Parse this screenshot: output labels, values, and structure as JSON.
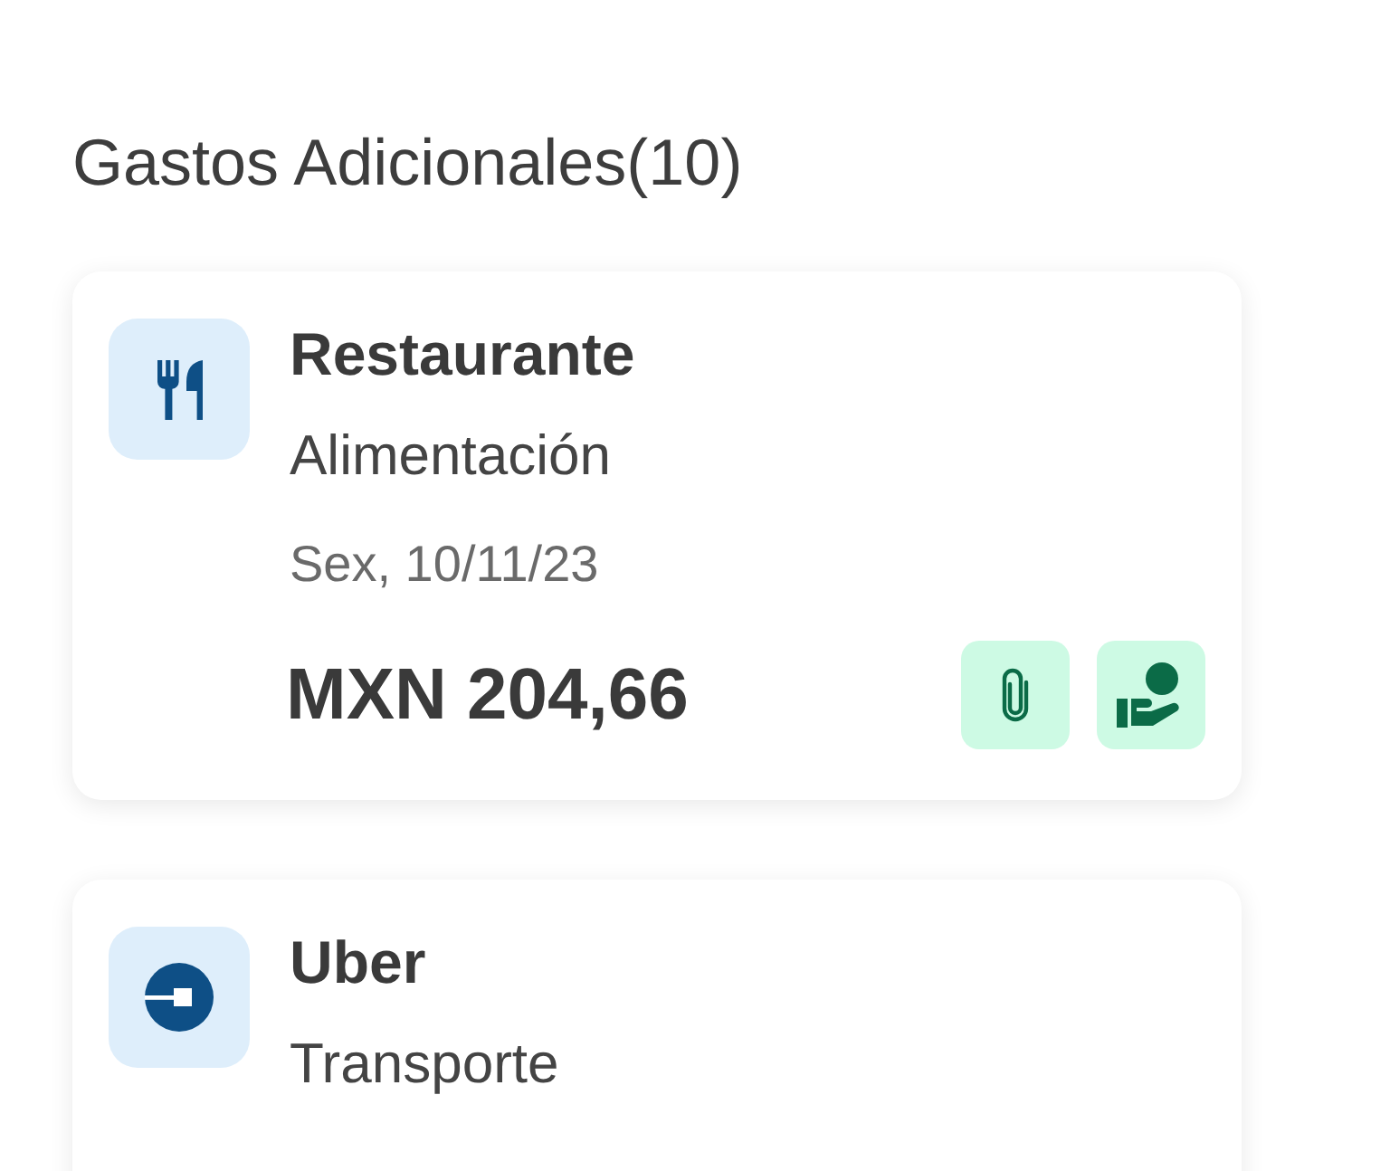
{
  "section": {
    "title": "Gastos Adicionales(10)"
  },
  "expenses": [
    {
      "kind": "food",
      "name": "Restaurante",
      "category": "Alimentación",
      "date": "Sex, 10/11/23",
      "amount": "MXN 204,66",
      "actions": [
        {
          "kind": "attachment"
        },
        {
          "kind": "reimbursement"
        }
      ]
    },
    {
      "kind": "transport",
      "name": "Uber",
      "category": "Transporte"
    }
  ]
}
